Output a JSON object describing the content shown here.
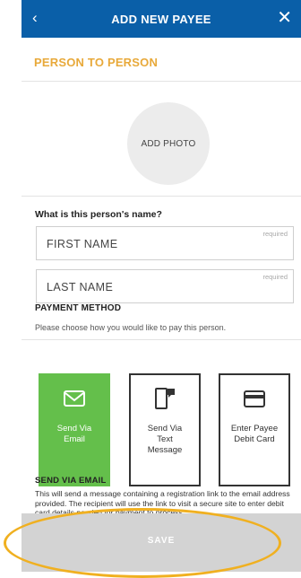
{
  "header": {
    "back_icon": "chevron-left-icon",
    "back_glyph": "‹",
    "title": "ADD NEW PAYEE",
    "close_icon": "close-icon",
    "close_glyph": "✕"
  },
  "section": {
    "title": "PERSON TO PERSON"
  },
  "photo": {
    "label": "ADD PHOTO"
  },
  "name": {
    "question": "What is this person's name?",
    "first": {
      "placeholder": "FIRST NAME",
      "required": "required"
    },
    "last": {
      "placeholder": "LAST NAME",
      "required": "required"
    }
  },
  "payment": {
    "title": "PAYMENT METHOD",
    "description": "Please choose how you would like to pay this person.",
    "options": [
      {
        "label": "Send Via\nEmail",
        "icon": "envelope-icon",
        "selected": true
      },
      {
        "label": "Send Via\nText\nMessage",
        "icon": "phone-message-icon",
        "selected": false
      },
      {
        "label": "Enter Payee\nDebit Card",
        "icon": "credit-card-icon",
        "selected": false
      }
    ]
  },
  "email_section": {
    "title": "SEND VIA EMAIL",
    "description": "This will send a message containing a registration link to the email address provided. The recipient will use the link to visit a secure site to enter debit card details needed for payment to process."
  },
  "footer": {
    "save_label": "SAVE"
  },
  "colors": {
    "header": "#0a5fa8",
    "accent": "#e8a93a",
    "selected": "#64bf4b",
    "save_disabled": "#d3d3d3",
    "highlight_ring": "#f0b020"
  }
}
